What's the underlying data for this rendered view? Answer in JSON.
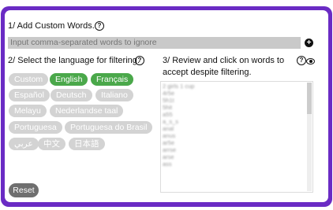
{
  "section1": {
    "title": "1/ Add Custom Words.",
    "help_icon": "question-circle-icon"
  },
  "input": {
    "placeholder": "Input comma-separated words to ignore"
  },
  "add_icon": "plus-circle-icon",
  "section2": {
    "title": "2/ Select the language for filtering.",
    "help_icon": "question-circle-icon"
  },
  "languages": [
    {
      "label": "Custom",
      "selected": false
    },
    {
      "label": "English",
      "selected": true
    },
    {
      "label": "Français",
      "selected": true
    },
    {
      "label": "Español",
      "selected": false
    },
    {
      "label": "Deutsch",
      "selected": false
    },
    {
      "label": "Italiano",
      "selected": false
    },
    {
      "label": "Melayu",
      "selected": false
    },
    {
      "label": "Nederlandse taal",
      "selected": false
    },
    {
      "label": "Portuguesa",
      "selected": false
    },
    {
      "label": "Portuguesa do Brasil",
      "selected": false
    },
    {
      "label": "عربي",
      "selected": false
    },
    {
      "label": "中文",
      "selected": false
    },
    {
      "label": "日本語",
      "selected": false
    }
  ],
  "section3": {
    "title_line1": "3/ Review and click on words to",
    "title_line2": "accept despite filtering.",
    "help_icon": "question-circle-icon",
    "eye_icon": "eye-icon"
  },
  "review_words": [
    "2 girls 1 cup",
    "4r5e",
    "5h1t",
    "5hit",
    "a55",
    "a_s_s",
    "anal",
    "anus",
    "ar5e",
    "arrse",
    "arse",
    "ass"
  ],
  "reset_label": "Reset",
  "colors": {
    "frame": "#6a2bc4",
    "selected_pill": "#4aa84a",
    "unselected_pill": "#d3d3d3",
    "reset_button": "#6f6f6f"
  }
}
